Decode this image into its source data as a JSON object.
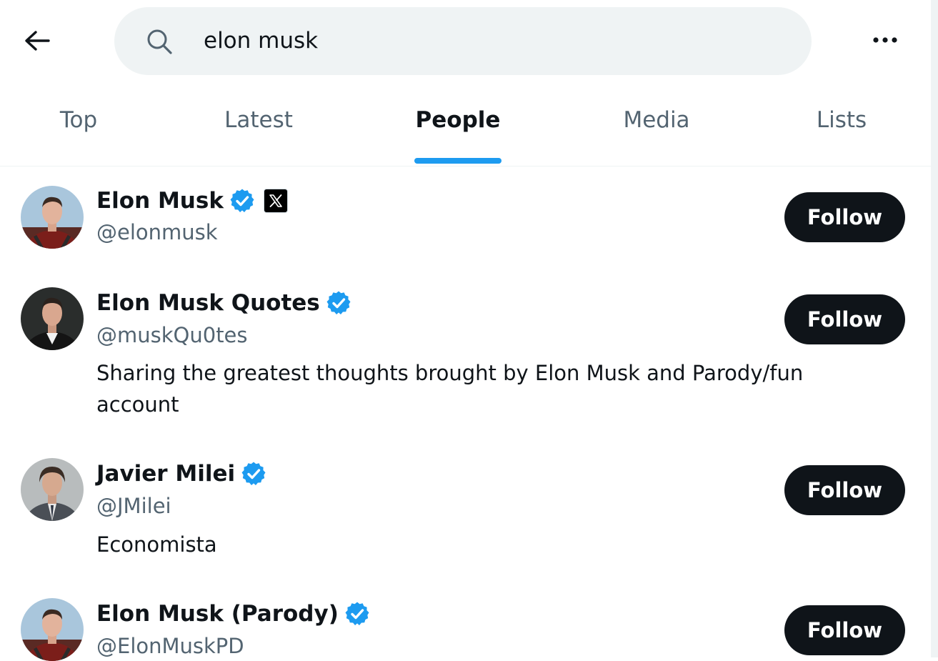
{
  "header": {
    "back_icon": "arrow-left-icon",
    "search": {
      "icon": "search-icon",
      "value": "elon musk"
    },
    "more_icon": "more-horizontal-icon"
  },
  "tabs": [
    {
      "label": "Top",
      "active": false
    },
    {
      "label": "Latest",
      "active": false
    },
    {
      "label": "People",
      "active": true
    },
    {
      "label": "Media",
      "active": false
    },
    {
      "label": "Lists",
      "active": false
    }
  ],
  "accent_color": "#1d9bf0",
  "users": [
    {
      "name": "Elon Musk",
      "verified": true,
      "affiliate_badge": "x-logo-icon",
      "handle": "@elonmusk",
      "bio": "",
      "follow_label": "Follow"
    },
    {
      "name": "Elon Musk Quotes",
      "verified": true,
      "handle": "@muskQu0tes",
      "bio": "Sharing the greatest thoughts brought by Elon Musk and Parody/fun account",
      "follow_label": "Follow"
    },
    {
      "name": "Javier Milei",
      "verified": true,
      "handle": "@JMilei",
      "bio": "Economista",
      "follow_label": "Follow"
    },
    {
      "name": "Elon Musk (Parody)",
      "verified": true,
      "handle": "@ElonMuskPD",
      "bio": "",
      "follow_label": "Follow"
    }
  ]
}
